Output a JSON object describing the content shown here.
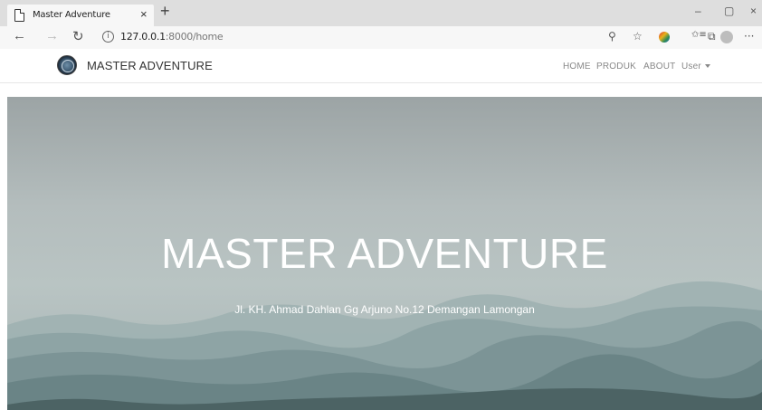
{
  "browser": {
    "tab_title": "Master Adventure",
    "tab_close": "×",
    "new_tab": "+",
    "minimize": "–",
    "restore": "▢",
    "close": "×",
    "back": "←",
    "forward": "→",
    "refresh": "↻",
    "info": "i",
    "url_host": "127.0.0.1",
    "url_path": ":8000/home",
    "icons": [
      "search-icon",
      "star-icon",
      "extension-icon",
      "favorites-icon",
      "collections-icon",
      "profile-icon",
      "more-icon"
    ],
    "search_glyph": "⚲",
    "star_glyph": "☆",
    "favorites_glyph": "✩≡",
    "collections_glyph": "⧉",
    "more_glyph": "···"
  },
  "navbar": {
    "brand": "MASTER ADVENTURE",
    "links": [
      "HOME",
      "PRODUK",
      "ABOUT",
      "User"
    ]
  },
  "hero": {
    "title": "MASTER ADVENTURE",
    "subtitle": "Jl. KH. Ahmad Dahlan Gg Arjuno No.12 Demangan Lamongan"
  },
  "colors": {
    "nav_text": "#888888",
    "brand_text": "#333333",
    "hero_text": "#ffffff"
  }
}
